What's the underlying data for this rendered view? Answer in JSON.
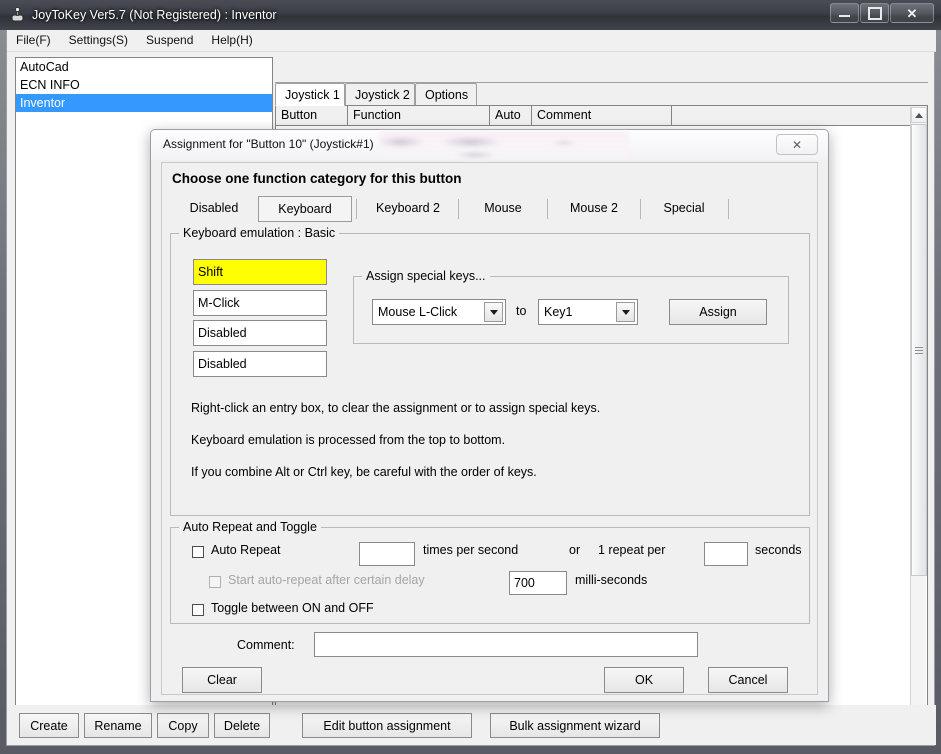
{
  "window": {
    "title": "JoyToKey Ver5.7 (Not Registered) : Inventor",
    "icon": "joystick-icon",
    "controls": {
      "minimize": "minimize-icon",
      "maximize": "maximize-icon",
      "close": "✕"
    }
  },
  "menu": {
    "items": [
      {
        "label": "File(F)"
      },
      {
        "label": "Settings(S)"
      },
      {
        "label": "Suspend"
      },
      {
        "label": "Help(H)"
      }
    ]
  },
  "profiles": {
    "items": [
      {
        "label": "AutoCad",
        "selected": false
      },
      {
        "label": "ECN INFO",
        "selected": false
      },
      {
        "label": "Inventor",
        "selected": true
      }
    ],
    "selected_color": "#3399ff"
  },
  "tabs": {
    "items": [
      {
        "label": "Joystick 1",
        "active": true
      },
      {
        "label": "Joystick 2",
        "active": false
      },
      {
        "label": "Options",
        "active": false
      }
    ]
  },
  "grid": {
    "columns": [
      "Button",
      "Function",
      "Auto",
      "Comment"
    ],
    "rows": [
      {
        "button": "Stick1: ←",
        "function": "Mouse: ←(50)",
        "auto": "---",
        "comment": ""
      }
    ]
  },
  "bottom_toolbar": {
    "profile_buttons": [
      {
        "label": "Create"
      },
      {
        "label": "Rename"
      },
      {
        "label": "Copy"
      },
      {
        "label": "Delete"
      }
    ],
    "action_buttons": [
      {
        "label": "Edit button assignment"
      },
      {
        "label": "Bulk assignment wizard"
      }
    ]
  },
  "dialog": {
    "title": "Assignment for \"Button 10\" (Joystick#1)",
    "close_label": "✕",
    "heading": "Choose one function category for this button",
    "category_tabs": [
      {
        "label": "Disabled",
        "active": false
      },
      {
        "label": "Keyboard",
        "active": true
      },
      {
        "label": "Keyboard 2",
        "active": false
      },
      {
        "label": "Mouse",
        "active": false
      },
      {
        "label": "Mouse 2",
        "active": false
      },
      {
        "label": "Special",
        "active": false
      }
    ],
    "keyboard_group": {
      "legend": "Keyboard emulation : Basic",
      "entries": [
        {
          "value": "Shift",
          "highlighted": true
        },
        {
          "value": "M-Click",
          "highlighted": false
        },
        {
          "value": "Disabled",
          "highlighted": false
        },
        {
          "value": "Disabled",
          "highlighted": false
        }
      ],
      "highlight_color": "#ffff00",
      "special_keys": {
        "legend": "Assign special keys...",
        "source_value": "Mouse L-Click",
        "to_label": "to",
        "target_value": "Key1",
        "assign_label": "Assign"
      },
      "hints": [
        "Right-click an entry box, to clear the assignment or to assign special keys.",
        "Keyboard emulation is processed from the top to bottom.",
        "If you combine Alt or Ctrl key, be careful with the order of keys."
      ]
    },
    "auto_repeat_group": {
      "legend": "Auto Repeat and Toggle",
      "auto_repeat_label": "Auto Repeat",
      "auto_repeat_checked": false,
      "rate_value": "",
      "times_per_second_label": "times per second",
      "or_label": "or",
      "one_repeat_per_label": "1 repeat per",
      "seconds_value": "",
      "seconds_label": "seconds",
      "delay_label": "Start auto-repeat after certain delay",
      "delay_checked": false,
      "delay_disabled": true,
      "delay_value": "700",
      "milliseconds_label": "milli-seconds",
      "toggle_label": "Toggle between ON and OFF",
      "toggle_checked": false
    },
    "comment_label": "Comment:",
    "comment_value": "",
    "buttons": {
      "clear": "Clear",
      "ok": "OK",
      "cancel": "Cancel"
    }
  }
}
